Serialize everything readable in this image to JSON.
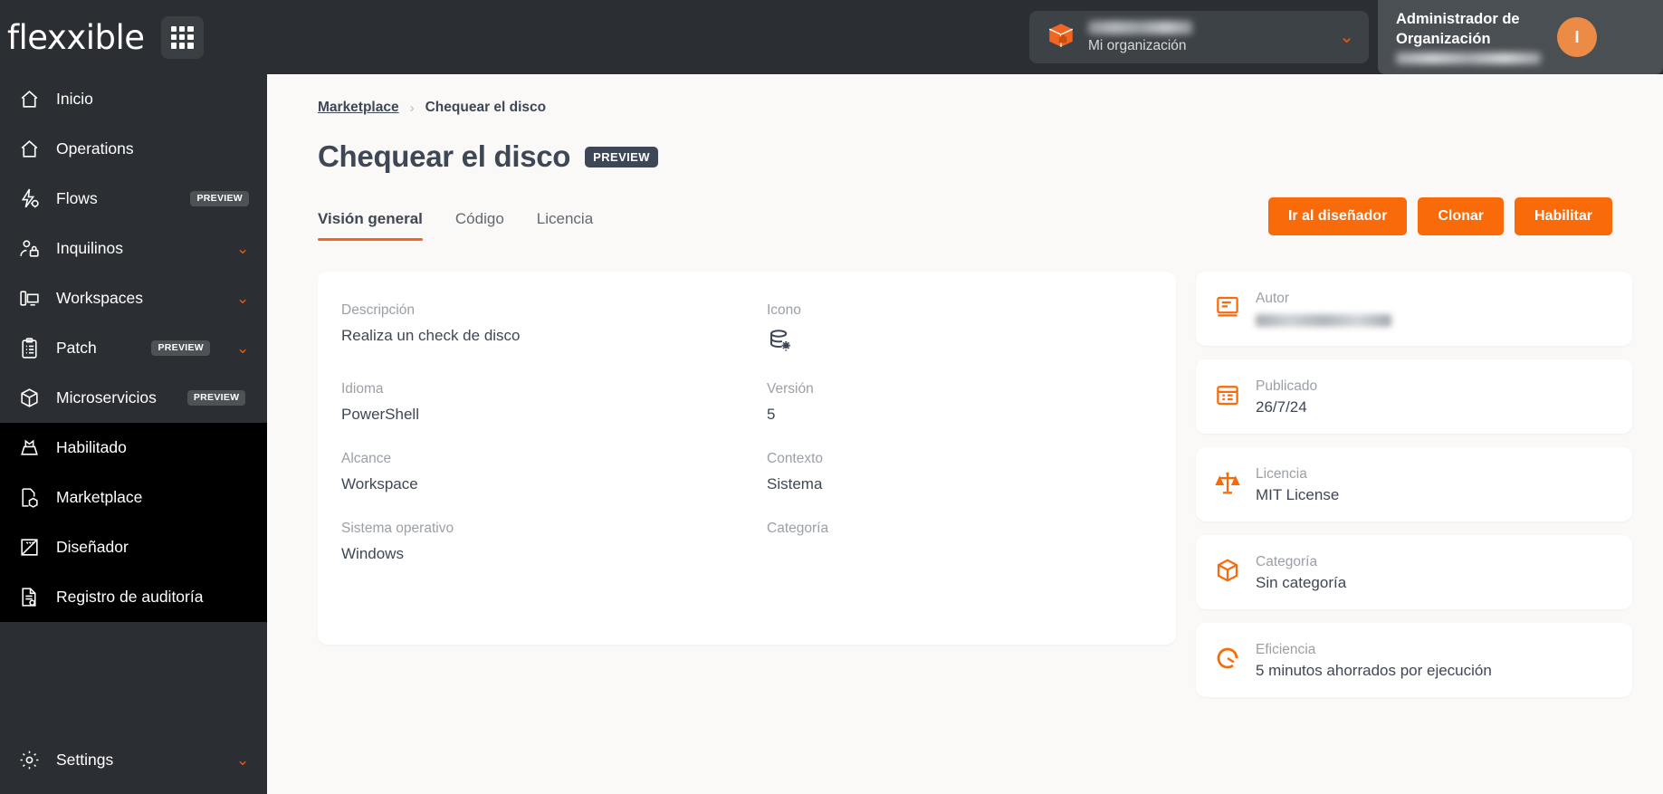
{
  "brand": {
    "logo_text": "flexxible",
    "apps_icon": "grid-apps-icon"
  },
  "topbar": {
    "org_picker": {
      "icon": "package-box-icon",
      "org_name": "",
      "subtitle": "Mi organización",
      "chevron": "chevron-down-icon"
    },
    "user": {
      "role_line1": "Administrador de",
      "role_line2": "Organización",
      "name": "",
      "avatar_initial": "I"
    }
  },
  "sidebar": {
    "items": [
      {
        "label": "Inicio",
        "icon": "home-icon",
        "badge": "",
        "chevron": ""
      },
      {
        "label": "Operations",
        "icon": "home-icon",
        "badge": "",
        "chevron": ""
      },
      {
        "label": "Flows",
        "icon": "flow-bolt-icon",
        "badge": "PREVIEW",
        "chevron": ""
      },
      {
        "label": "Inquilinos",
        "icon": "tenants-icon",
        "badge": "",
        "chevron": "chevron-down-icon"
      },
      {
        "label": "Workspaces",
        "icon": "workspace-icon",
        "badge": "",
        "chevron": "chevron-down-icon"
      },
      {
        "label": "Patch",
        "icon": "clipboard-icon",
        "badge": "PREVIEW",
        "chevron": "chevron-down-icon"
      },
      {
        "label": "Microservicios",
        "icon": "cube-icon",
        "badge": "PREVIEW",
        "chevron": "chevron-up-icon"
      }
    ],
    "submenu": [
      {
        "label": "Habilitado",
        "icon": "inbox-check-icon"
      },
      {
        "label": "Marketplace",
        "icon": "marketplace-icon"
      },
      {
        "label": "Diseñador",
        "icon": "designer-ruler-icon"
      },
      {
        "label": "Registro de auditoría",
        "icon": "audit-log-icon"
      }
    ],
    "settings": {
      "label": "Settings",
      "icon": "gear-icon",
      "chevron": "chevron-down-icon"
    }
  },
  "breadcrumb": {
    "parent": "Marketplace",
    "separator": "›",
    "current": "Chequear el disco"
  },
  "page": {
    "title": "Chequear el disco",
    "badge": "PREVIEW"
  },
  "tabs": [
    {
      "label": "Visión general",
      "active": true
    },
    {
      "label": "Código",
      "active": false
    },
    {
      "label": "Licencia",
      "active": false
    }
  ],
  "actions": [
    {
      "label": "Ir al diseñador"
    },
    {
      "label": "Clonar"
    },
    {
      "label": "Habilitar"
    }
  ],
  "overview": {
    "descripcion": {
      "label": "Descripción",
      "value": "Realiza un check de disco"
    },
    "icono": {
      "label": "Icono",
      "icon": "database-gear-icon"
    },
    "idioma": {
      "label": "Idioma",
      "value": "PowerShell"
    },
    "version": {
      "label": "Versión",
      "value": "5"
    },
    "alcance": {
      "label": "Alcance",
      "value": "Workspace"
    },
    "contexto": {
      "label": "Contexto",
      "value": "Sistema"
    },
    "sistema_operativo": {
      "label": "Sistema operativo",
      "value": "Windows"
    },
    "categoria": {
      "label": "Categoría",
      "value": ""
    }
  },
  "info_cards": [
    {
      "label": "Autor",
      "value": "",
      "icon": "author-book-icon",
      "redacted": true
    },
    {
      "label": "Publicado",
      "value": "26/7/24",
      "icon": "calendar-icon",
      "redacted": false
    },
    {
      "label": "Licencia",
      "value": "MIT License",
      "icon": "scales-icon",
      "redacted": false
    },
    {
      "label": "Categoría",
      "value": "Sin categoría",
      "icon": "box-icon",
      "redacted": false
    },
    {
      "label": "Eficiencia",
      "value": "5 minutos ahorrados por ejecución",
      "icon": "gauge-icon",
      "redacted": false
    }
  ],
  "colors": {
    "accent_orange": "#f96a0b",
    "sidebar_bg": "#2b2f33",
    "submenu_bg": "#000000",
    "page_bg": "#faf9f7",
    "text_dark": "#3e4756",
    "text_muted": "#9ba0a6",
    "avatar_bg": "#ec8b46"
  }
}
